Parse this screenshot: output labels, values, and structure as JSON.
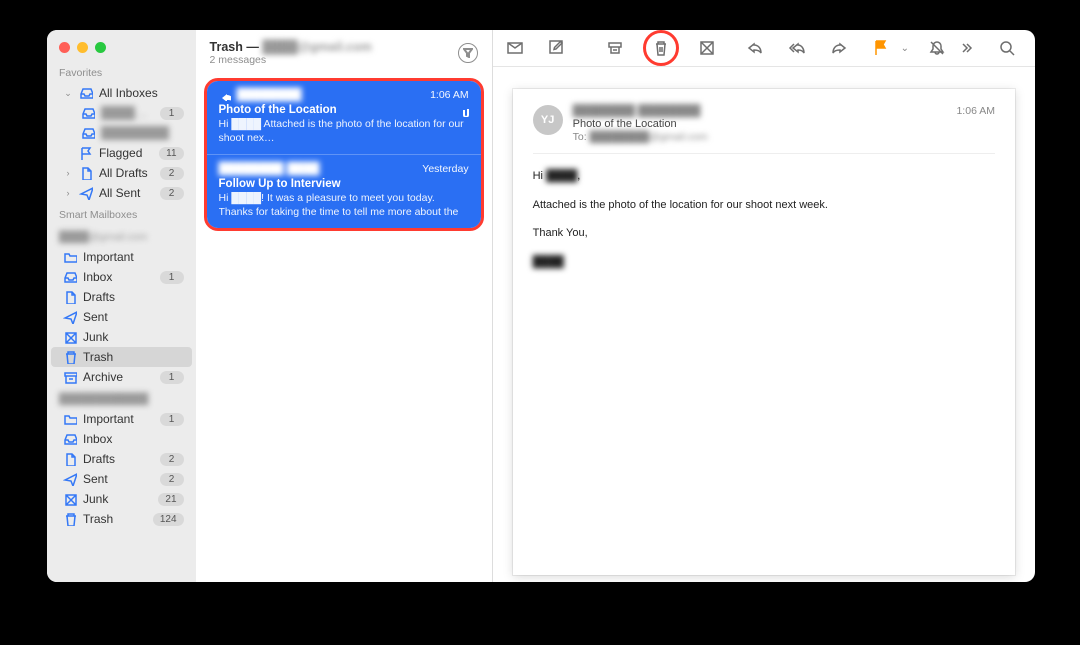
{
  "sidebar": {
    "favorites_label": "Favorites",
    "smart_label": "Smart Mailboxes",
    "items": [
      {
        "label": "All Inboxes",
        "icon": "inbox",
        "expanded": true
      },
      {
        "label": "████@g…",
        "icon": "inbox",
        "badge": "1",
        "sub": true,
        "blur": true
      },
      {
        "label": "████████",
        "icon": "inbox",
        "sub": true,
        "blur": true
      },
      {
        "label": "Flagged",
        "icon": "flag",
        "badge": "11"
      },
      {
        "label": "All Drafts",
        "icon": "doc",
        "badge": "2",
        "disc": true
      },
      {
        "label": "All Sent",
        "icon": "sent",
        "badge": "2",
        "disc": true
      }
    ],
    "account1": {
      "name": "████@gmail.com",
      "items": [
        {
          "label": "Important",
          "icon": "folder"
        },
        {
          "label": "Inbox",
          "icon": "inbox",
          "badge": "1"
        },
        {
          "label": "Drafts",
          "icon": "doc"
        },
        {
          "label": "Sent",
          "icon": "sent"
        },
        {
          "label": "Junk",
          "icon": "junk"
        },
        {
          "label": "Trash",
          "icon": "trash",
          "selected": true
        },
        {
          "label": "Archive",
          "icon": "archive",
          "badge": "1"
        }
      ]
    },
    "account2": {
      "name": "████████████",
      "items": [
        {
          "label": "Important",
          "icon": "folder",
          "badge": "1"
        },
        {
          "label": "Inbox",
          "icon": "inbox"
        },
        {
          "label": "Drafts",
          "icon": "doc",
          "badge": "2"
        },
        {
          "label": "Sent",
          "icon": "sent",
          "badge": "2"
        },
        {
          "label": "Junk",
          "icon": "junk",
          "badge": "21"
        },
        {
          "label": "Trash",
          "icon": "trash",
          "badge": "124"
        }
      ]
    }
  },
  "list": {
    "title_prefix": "Trash — ",
    "title_account": "████@gmail.com",
    "subtitle": "2 messages",
    "messages": [
      {
        "sender": "████████",
        "time": "1:06 AM",
        "subject": "Photo of the Location",
        "preview": "Hi ████ Attached is the photo of the location for our shoot nex…",
        "has_attach": true,
        "has_reply": true
      },
      {
        "sender": "████████ ████",
        "time": "Yesterday",
        "subject": "Follow Up to Interview",
        "preview": "Hi ████! It was a pleasure to meet you today. Thanks for taking the time to tell me more about the company and the position. I…"
      }
    ]
  },
  "reader": {
    "avatar": "YJ",
    "from": "████████ ████████",
    "subject": "Photo of the Location",
    "to_label": "To:",
    "to_addr": "████████@gmail.com",
    "time": "1:06 AM",
    "greeting_prefix": "Hi ",
    "greeting_name": "████",
    "greeting_suffix": ",",
    "line1": "Attached is the photo of the location for our shoot next week.",
    "thanks": "Thank You,",
    "sig_name": "████"
  }
}
